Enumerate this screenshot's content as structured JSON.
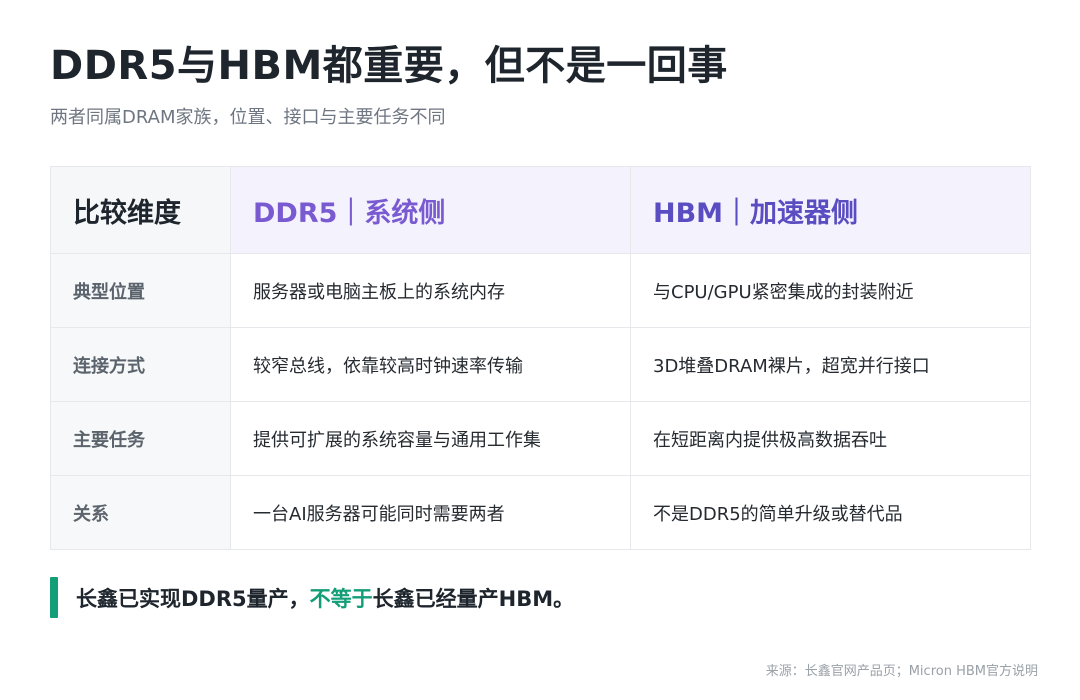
{
  "title": "DDR5与HBM都重要，但不是一回事",
  "subtitle": "两者同属DRAM家族，位置、接口与主要任务不同",
  "table": {
    "headers": {
      "dimension": "比较维度",
      "ddr5": "DDR5｜系统侧",
      "hbm": "HBM｜加速器侧"
    },
    "rows": [
      {
        "dimension": "典型位置",
        "ddr5": "服务器或电脑主板上的系统内存",
        "hbm": "与CPU/GPU紧密集成的封装附近"
      },
      {
        "dimension": "连接方式",
        "ddr5": "较窄总线，依靠较高时钟速率传输",
        "hbm": "3D堆叠DRAM裸片，超宽并行接口"
      },
      {
        "dimension": "主要任务",
        "ddr5": "提供可扩展的系统容量与通用工作集",
        "hbm": "在短距离内提供极高数据吞吐"
      },
      {
        "dimension": "关系",
        "ddr5": "一台AI服务器可能同时需要两者",
        "hbm": "不是DDR5的简单升级或替代品"
      }
    ]
  },
  "callout": {
    "part1": "长鑫已实现DDR5量产，",
    "highlight": "不等于",
    "part2": "长鑫已经量产HBM。"
  },
  "source": "来源：长鑫官网产品页；Micron HBM官方说明",
  "colors": {
    "ddr5_header": "#7a5ad1",
    "hbm_header": "#5a4dc1",
    "accent_green": "#139e78"
  }
}
